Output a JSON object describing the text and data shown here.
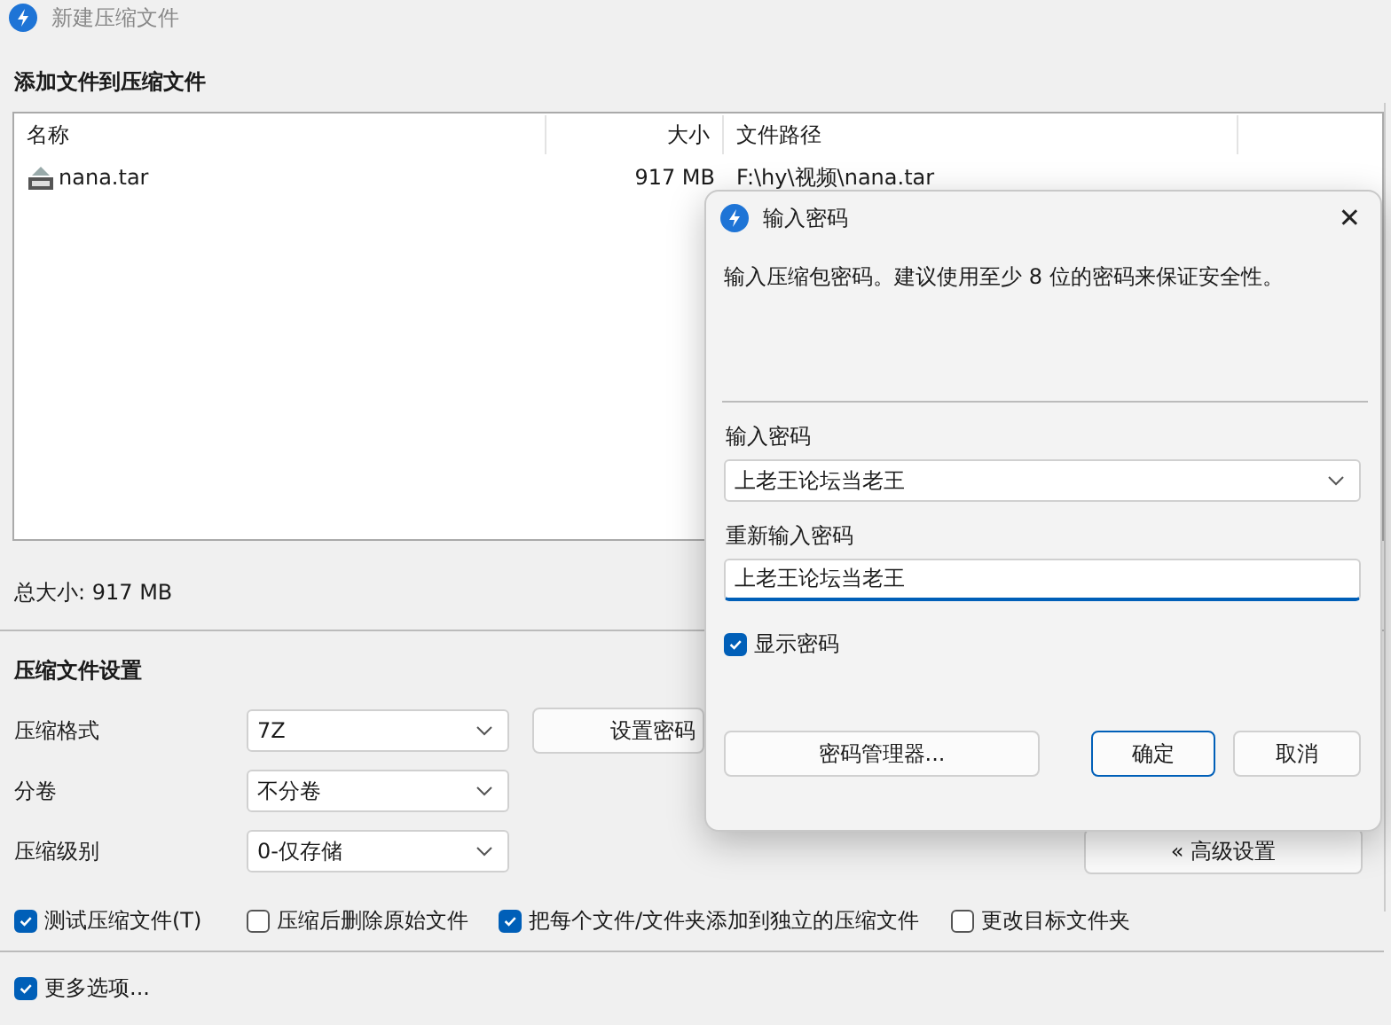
{
  "window": {
    "title": "新建压缩文件"
  },
  "files": {
    "heading": "添加文件到压缩文件",
    "columns": [
      "名称",
      "大小",
      "文件路径"
    ],
    "rows": [
      {
        "name": "nana.tar",
        "size": "917 MB",
        "path": "F:\\hy\\视频\\nana.tar"
      }
    ],
    "total": "总大小: 917 MB"
  },
  "settings": {
    "heading": "压缩文件设置",
    "fields": [
      {
        "label": "压缩格式",
        "value": "7Z"
      },
      {
        "label": "分卷",
        "value": "不分卷"
      },
      {
        "label": "压缩级别",
        "value": "0-仅存储"
      }
    ],
    "password_button": "设置密码",
    "advanced_button": "« 高级设置",
    "options": [
      {
        "label": "测试压缩文件(T)",
        "checked": true
      },
      {
        "label": "压缩后删除原始文件",
        "checked": false
      },
      {
        "label": "把每个文件/文件夹添加到独立的压缩文件",
        "checked": true
      },
      {
        "label": "更改目标文件夹",
        "checked": false
      }
    ],
    "more_options": {
      "label": "更多选项...",
      "checked": true
    }
  },
  "dialog": {
    "title": "输入密码",
    "close": "✕",
    "description": "输入压缩包密码。建议使用至少 8 位的密码来保证安全性。",
    "password_label": "输入密码",
    "password_value": "上老王论坛当老王",
    "repeat_label": "重新输入密码",
    "repeat_value": "上老王论坛当老王",
    "show_password": {
      "label": "显示密码",
      "checked": true
    },
    "buttons": [
      "密码管理器...",
      "确定",
      "取消"
    ]
  }
}
